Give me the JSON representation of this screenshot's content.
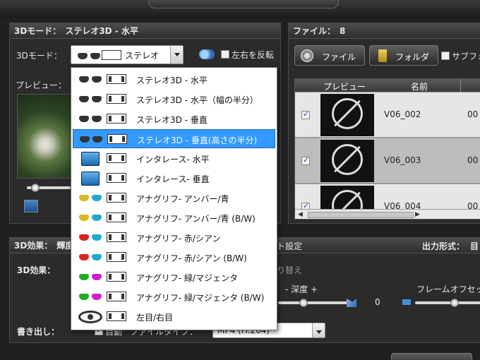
{
  "left_panel": {
    "title_label": "3Dモード：",
    "title_value": "ステレオ3D - 水平",
    "mode_label": "3Dモード：",
    "mode_selected": "ステレオ",
    "swap_label": "左右を反転",
    "preview_label": "プレビュー："
  },
  "right_panel": {
    "title_label": "ファイル：",
    "file_count": "8",
    "file_button": "ファイル",
    "folder_button": "フォルダ",
    "subfolder_label": "サブフォ",
    "columns": [
      "プレビュー",
      "名前"
    ],
    "rows": [
      {
        "name": "V06_002",
        "extra": "00",
        "checked": true
      },
      {
        "name": "V06_003",
        "extra": "00",
        "checked": true
      },
      {
        "name": "V06_004",
        "extra": "00",
        "checked": true
      }
    ]
  },
  "effects_panel": {
    "title_label": "3D効果：",
    "title_value": "輝度",
    "settings_fragment": "ト設定",
    "output_label": "出力形式：",
    "output_value": "目",
    "effect_label": "3D効果：",
    "switch_fragment": "り替え",
    "depth_label": "- 深度 +",
    "depth_value": "0",
    "frame_offset_label": "フレームオフセッ",
    "export_label": "書き出し：",
    "auto_label": "自動",
    "file_type_label": "ファイルタイプ：",
    "file_type_value": "MP4 (H.264)"
  },
  "dropdown": {
    "items": [
      {
        "label": "ステレオ3D - 水平",
        "icon": "shutter-glasses-icon",
        "icon2": "side-by-side-icon"
      },
      {
        "label": "ステレオ3D - 水平（幅の半分）",
        "icon": "shutter-glasses-icon",
        "icon2": "half-side-by-side-icon"
      },
      {
        "label": "ステレオ3D - 垂直",
        "icon": "passive-glasses-icon",
        "icon2": "top-bottom-icon"
      },
      {
        "label": "ステレオ3D - 垂直(高さの半分)",
        "icon": "passive-glasses-icon",
        "icon2": "half-top-bottom-icon"
      },
      {
        "label": "インタレース- 水平",
        "icon": "monitor-icon",
        "icon2": "horizontal-interlace-icon"
      },
      {
        "label": "インタレース- 垂直",
        "icon": "monitor-icon",
        "icon2": "vertical-interlace-icon"
      },
      {
        "label": "アナグリフ- アンバー/青",
        "icon": "amber-blue-glasses-icon",
        "icon2": "film-icon"
      },
      {
        "label": "アナグリフ- アンバー/青 (B/W)",
        "icon": "amber-blue-glasses-icon",
        "icon2": "film-icon"
      },
      {
        "label": "アナグリフ- 赤/シアン",
        "icon": "red-cyan-glasses-icon",
        "icon2": "film-icon"
      },
      {
        "label": "アナグリフ- 赤/シアン (B/W)",
        "icon": "red-cyan-glasses-icon",
        "icon2": "film-icon"
      },
      {
        "label": "アナグリフ- 緑/マジェンタ",
        "icon": "green-magenta-glasses-icon",
        "icon2": "film-icon"
      },
      {
        "label": "アナグリフ- 緑/マジェンタ (B/W)",
        "icon": "green-magenta-glasses-icon",
        "icon2": "film-icon"
      },
      {
        "label": "左目/右目",
        "icon": "eye-icon",
        "icon2": "film-icon"
      }
    ],
    "selected_index": 3
  },
  "colors": {
    "selection": "#3399ff",
    "panel_bg": "#2b2b2b",
    "list_row_light": "#e6e6e6",
    "list_row_dark": "#bdbdbd"
  }
}
